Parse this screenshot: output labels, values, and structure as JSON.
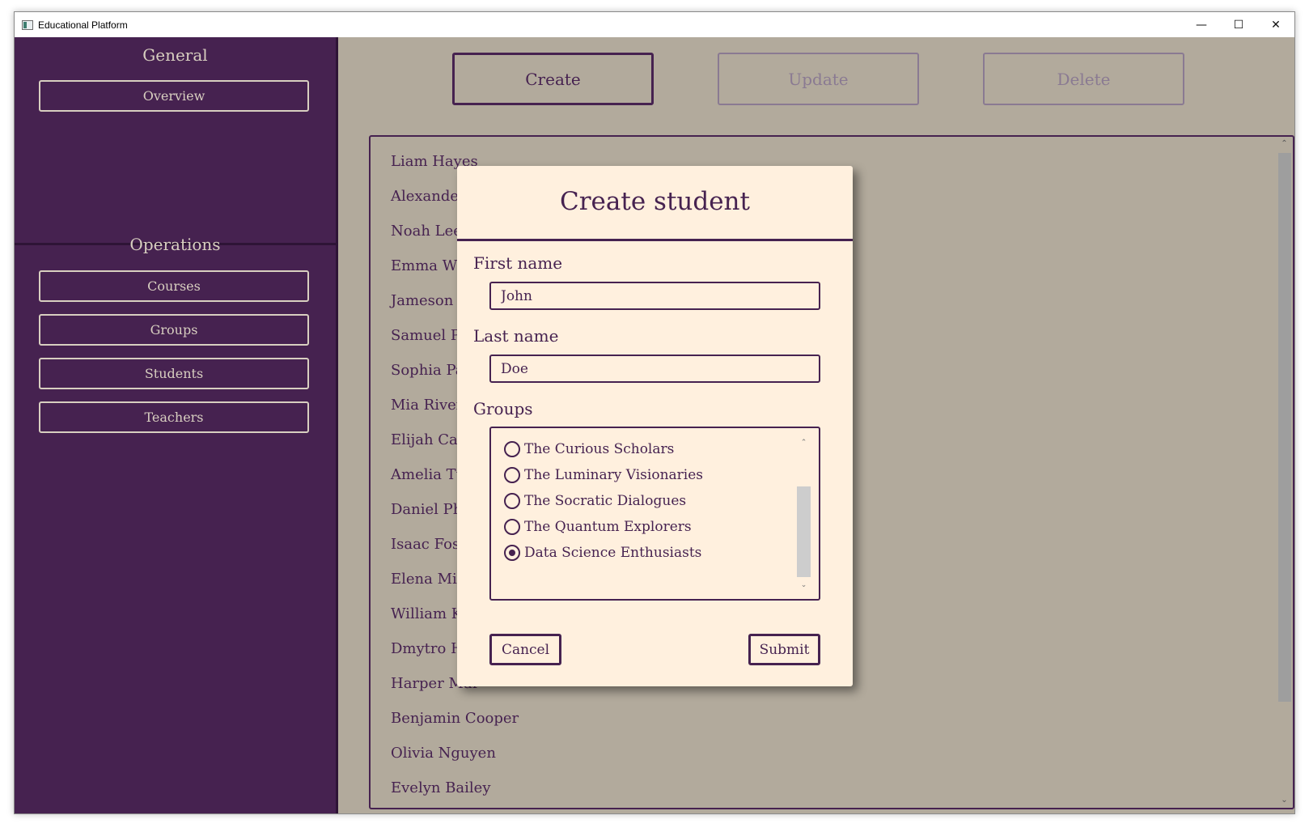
{
  "window": {
    "title": "Educational Platform",
    "controls": [
      "minimize",
      "maximize",
      "close"
    ]
  },
  "sidebar": {
    "general_title": "General",
    "general_items": [
      {
        "label": "Overview"
      }
    ],
    "operations_title": "Operations",
    "operations_items": [
      {
        "label": "Courses"
      },
      {
        "label": "Groups"
      },
      {
        "label": "Students"
      },
      {
        "label": "Teachers"
      }
    ]
  },
  "toolbar": {
    "create_label": "Create",
    "update_label": "Update",
    "delete_label": "Delete",
    "update_enabled": false,
    "delete_enabled": false
  },
  "students": [
    "Liam Hayes",
    "Alexander I",
    "Noah Lee",
    "Emma Wrig",
    "Jameson St",
    "Samuel Pri",
    "Sophia Pate",
    "Mia Rivera",
    "Elijah Carte",
    "Amelia Tur",
    "Daniel Phil",
    "Isaac Foste",
    "Elena Mitcl",
    "William Ki",
    "Dmytro Ho",
    "Harper Mar",
    "Benjamin Cooper",
    "Olivia Nguyen",
    "Evelyn Bailey"
  ],
  "dialog": {
    "title": "Create student",
    "first_name_label": "First name",
    "first_name_value": "John",
    "last_name_label": "Last name",
    "last_name_value": "Doe",
    "groups_label": "Groups",
    "groups": [
      {
        "label": "The Curious Scholars",
        "checked": false
      },
      {
        "label": "The Luminary Visionaries",
        "checked": false
      },
      {
        "label": "The Socratic Dialogues",
        "checked": false
      },
      {
        "label": "The Quantum Explorers",
        "checked": false
      },
      {
        "label": "Data Science Enthusiasts",
        "checked": true
      }
    ],
    "cancel_label": "Cancel",
    "submit_label": "Submit"
  },
  "colors": {
    "sidebar_bg": "#462250",
    "main_bg": "#b2aa9c",
    "accent": "#462250",
    "dialog_bg": "#fff0de",
    "sidebar_text": "#d8cfc0"
  }
}
